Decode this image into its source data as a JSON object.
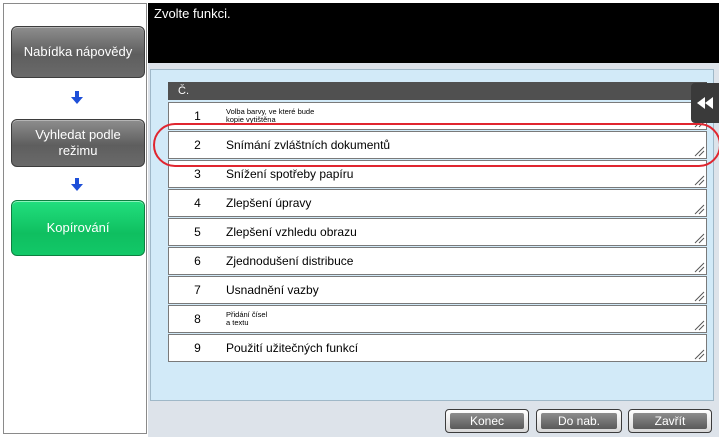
{
  "header": {
    "title": "Zvolte funkci."
  },
  "sidebar": {
    "help_label": "Nabídka nápovědy",
    "mode_label": "Vyhledat podle\nrežimu",
    "copy_label": "Kopírování"
  },
  "table": {
    "column_header": "Č.",
    "rows": [
      {
        "num": "1",
        "label": "Volba barvy, ve které bude\nkopie vytištěna",
        "small": true
      },
      {
        "num": "2",
        "label": "Snímání zvláštních dokumentů",
        "small": false,
        "highlighted": true
      },
      {
        "num": "3",
        "label": "Snížení spotřeby papíru",
        "small": false
      },
      {
        "num": "4",
        "label": "Zlepšení úpravy",
        "small": false
      },
      {
        "num": "5",
        "label": "Zlepšení vzhledu obrazu",
        "small": false
      },
      {
        "num": "6",
        "label": "Zjednodušení distribuce",
        "small": false
      },
      {
        "num": "7",
        "label": "Usnadnění vazby",
        "small": false
      },
      {
        "num": "8",
        "label": "Přidání čísel\na textu",
        "small": true
      },
      {
        "num": "9",
        "label": "Použití užitečných funkcí",
        "small": false
      }
    ]
  },
  "footer": {
    "konec_label": "Konec",
    "donab_label": "Do nab.",
    "zavrit_label": "Zavřít"
  },
  "colors": {
    "highlight": "#e0262f",
    "selected_mode": "#12c868",
    "panel_bg": "#d2eaf8"
  },
  "icons": {
    "nav_arrow": "arrow-down-icon",
    "collapse": "double-chevron-left-icon",
    "row_corner": "resize-corner-icon"
  }
}
